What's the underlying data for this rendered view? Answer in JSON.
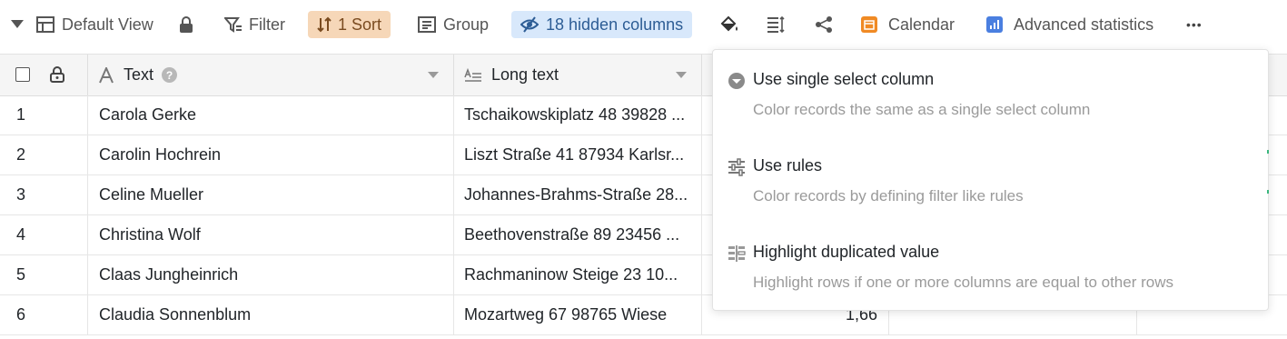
{
  "toolbar": {
    "view_name": "Default View",
    "filter": "Filter",
    "sort": "1 Sort",
    "group": "Group",
    "hidden": "18 hidden columns",
    "calendar": "Calendar",
    "stats": "Advanced statistics",
    "more": "•••"
  },
  "columns": {
    "text": "Text",
    "longtext": "Long text"
  },
  "rows": [
    {
      "n": "1",
      "text": "Carola Gerke",
      "long": "Tschaikowskiplatz 48 39828 ..."
    },
    {
      "n": "2",
      "text": "Carolin Hochrein",
      "long": "Liszt Straße 41 87934 Karlsr..."
    },
    {
      "n": "3",
      "text": "Celine Mueller",
      "long": "Johannes-Brahms-Straße 28..."
    },
    {
      "n": "4",
      "text": "Christina Wolf",
      "long": "Beethovenstraße 89 23456 ..."
    },
    {
      "n": "5",
      "text": "Claas Jungheinrich",
      "long": "Rachmaninow Steige 23 10..."
    },
    {
      "n": "6",
      "text": "Claudia Sonnenblum",
      "long": "Mozartweg 67 98765 Wiese",
      "num": "1,66"
    }
  ],
  "menu": {
    "items": [
      {
        "title": "Use single select column",
        "desc": "Color records the same as a single select column"
      },
      {
        "title": "Use rules",
        "desc": "Color records by defining filter like rules"
      },
      {
        "title": "Highlight duplicated value",
        "desc": "Highlight rows if one or more columns are equal to other rows"
      }
    ]
  }
}
